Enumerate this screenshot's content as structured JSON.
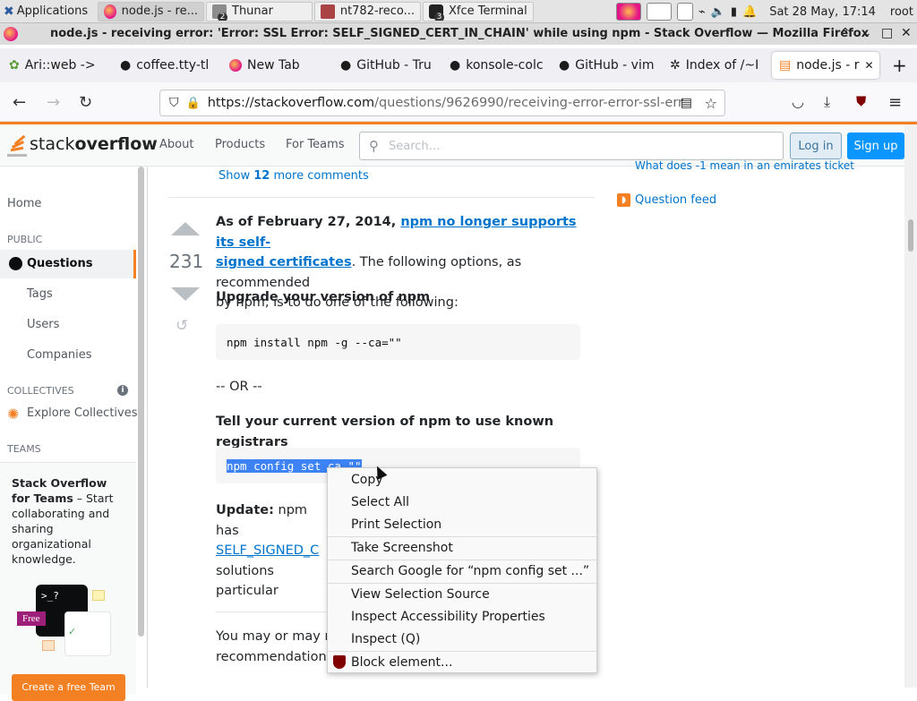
{
  "taskbar": {
    "applications_label": "Applications",
    "tasks": [
      {
        "label": "node.js - re...",
        "icon": "firefox-icon",
        "active": true
      },
      {
        "label": "Thunar",
        "icon": "folder-icon",
        "badge": "2"
      },
      {
        "label": "nt782-reco...",
        "icon": "image-icon"
      },
      {
        "label": "Xfce Terminal",
        "icon": "terminal-icon",
        "badge": "3"
      }
    ],
    "clock": "Sat 28 May, 17:14",
    "user": "root"
  },
  "window": {
    "title": "node.js - receiving error: 'Error: SSL Error: SELF_SIGNED_CERT_IN_CHAIN' while using npm - Stack Overflow — Mozilla Firefox",
    "controls": [
      "⌃",
      "⌄",
      "□",
      "✕"
    ]
  },
  "bookmarks": [
    {
      "label": "Ari::web ->",
      "icon": "leaf-icon"
    },
    {
      "label": "coffee.tty-tl",
      "icon": "github-icon"
    },
    {
      "label": "New Tab",
      "icon": "firefox-icon"
    },
    {
      "label": "GitHub - Tru",
      "icon": "github-icon"
    },
    {
      "label": "konsole-colc",
      "icon": "github-icon"
    },
    {
      "label": "GitHub - vim",
      "icon": "github-icon"
    },
    {
      "label": "Index of /~I",
      "icon": "bug-icon"
    },
    {
      "label": "node.js - r",
      "icon": "so-icon",
      "active": true
    }
  ],
  "urlbar": {
    "host": "https://stackoverflow.com",
    "path": "/questions/9626990/receiving-error-error-ssl-err"
  },
  "so_header": {
    "logo_text_light": "stack",
    "logo_text_bold": "overflow",
    "nav": [
      "About",
      "Products",
      "For Teams"
    ],
    "search_placeholder": "Search…",
    "login": "Log in",
    "signup": "Sign up"
  },
  "sidebar": {
    "home": "Home",
    "public_head": "PUBLIC",
    "questions": "Questions",
    "tags": "Tags",
    "users": "Users",
    "companies": "Companies",
    "collectives_head": "COLLECTIVES",
    "explore_collectives": "Explore Collectives",
    "teams_head": "TEAMS",
    "teams_title": "Stack Overflow for Teams",
    "teams_desc": " – Start collaborating and sharing organizational knowledge.",
    "free_badge": "Free",
    "create_team": "Create a free Team"
  },
  "answer": {
    "show_more_prefix": "Show ",
    "show_more_count": "12",
    "show_more_suffix": " more comments",
    "vote_count": "231",
    "p1_bold": "As of February 27, 2014, ",
    "p1_link_line1": "npm no longer supports its self-",
    "p1_link_line2": "signed certificates",
    "p1_rest_line1": ". The following options, as recommended",
    "p1_rest_line2": "by npm, is to do one of the following:",
    "h_upgrade": "Upgrade your version of npm",
    "code1": "npm install npm -g --ca=\"\"",
    "or_text": "-- OR --",
    "h_tell": "Tell your current version of npm to use known registrars",
    "code2": "npm config set ca \"\"",
    "update_bold": "Update:",
    "update_text": " npm has",
    "update_link": "SELF_SIGNED_C",
    "update_line3": "solutions particular",
    "footer_line1": "You may or may no",
    "footer_line2": "recommendations."
  },
  "rightcol": {
    "cut_link": "What does -1 mean in an emirates ticket",
    "question_feed": "Question feed"
  },
  "context_menu": {
    "items": [
      {
        "label": "Copy",
        "underline": "y"
      },
      {
        "label": "Select All",
        "underline": "A"
      },
      {
        "label": "Print Selection",
        "underline": "r"
      },
      {
        "label": "Take Screenshot",
        "underline": "T"
      },
      {
        "label": "Search Google for “npm config set ...”",
        "underline": "S"
      },
      {
        "label": "View Selection Source",
        "underline": "e"
      },
      {
        "label": "Inspect Accessibility Properties"
      },
      {
        "label": "Inspect (Q)",
        "underline": "Q"
      },
      {
        "label": "Block element...",
        "icon": "ublock-icon"
      }
    ]
  },
  "colors": {
    "so_orange": "#f48024",
    "so_blue": "#0a95ff",
    "link": "#0074cc",
    "selection": "#3d83f5"
  }
}
